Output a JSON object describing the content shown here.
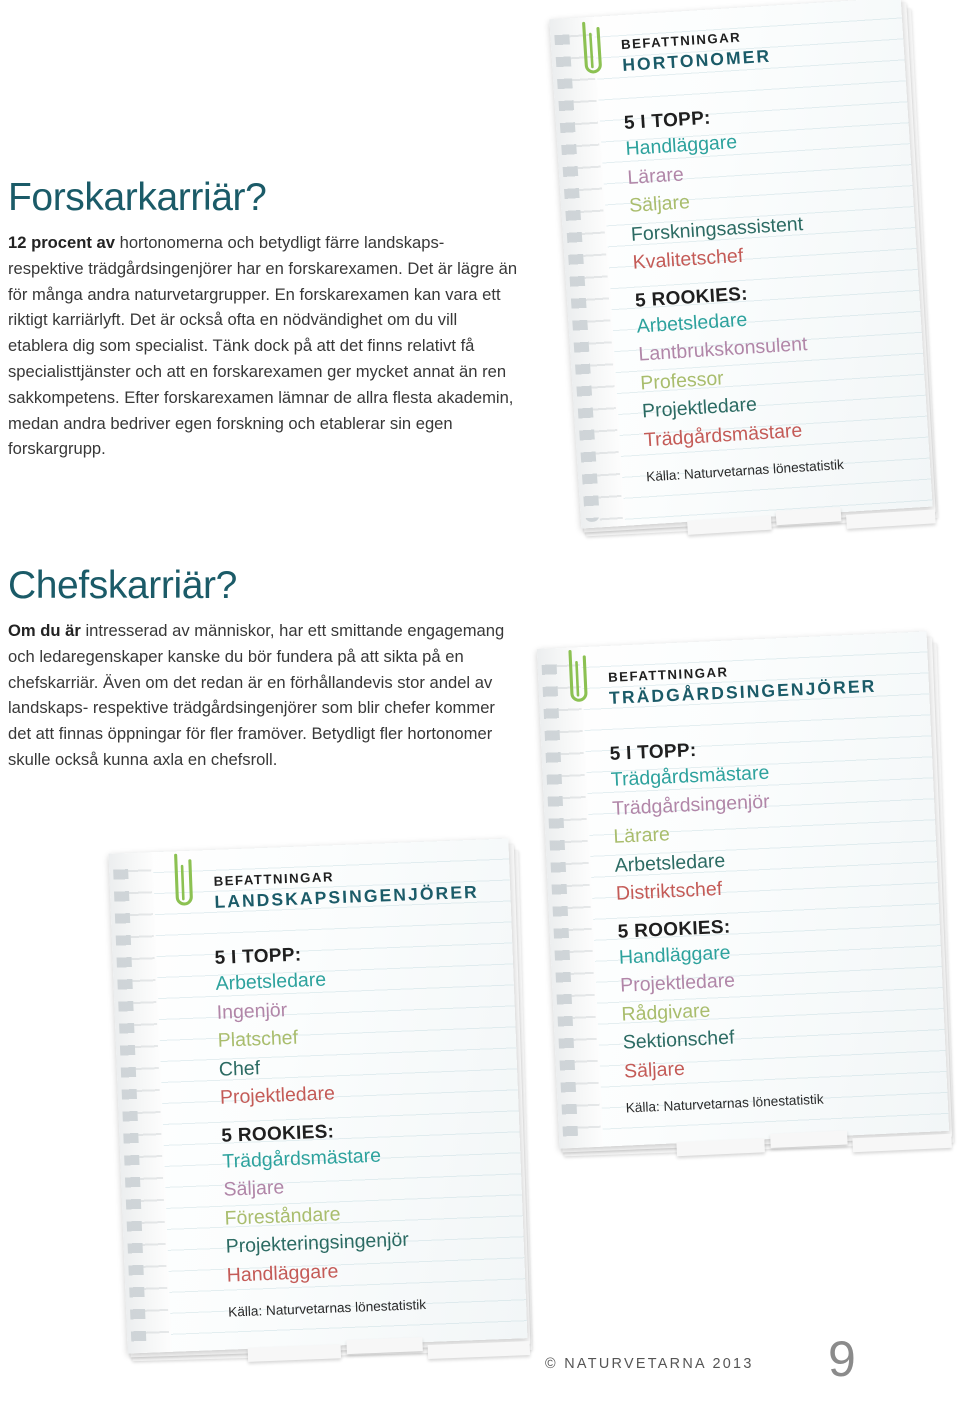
{
  "page": {
    "number": "9",
    "copyright": "© NATURVETARNA 2013"
  },
  "sections": [
    {
      "id": "forskarkarriar",
      "headline": "Forskarkarriär?",
      "lead": "12 procent av",
      "body": " hortonomerna och betydligt färre landskaps- respektive trädgårdsingenjörer har en forskarexamen. Det är lägre än för många andra naturvetargrupper. En forskarexamen kan vara ett riktigt karriärlyft. Det är också ofta en nödvändighet om du vill etablera dig som specialist. Tänk dock på att det finns relativt få specialisttjänster och att en forskarexamen ger mycket annat än ren sakkompetens. Efter forskarexamen lämnar de allra flesta akademin, medan andra bedriver egen forskning och etablerar sin egen forskargrupp."
    },
    {
      "id": "chefskarriar",
      "headline": "Chefskarriär?",
      "lead": "Om du är",
      "body": " intresserad av människor, har ett smittande engagemang och ledaregenskaper kanske du bör fundera på att sikta på en chefskarriär. Även om det redan är en förhållandevis stor andel av landskaps- respektive trädgårdsingenjörer som blir chefer kommer det att finnas öppningar för fler framöver. Betydligt fler hortonomer skulle också kunna axla en chefsroll."
    }
  ],
  "notepads": [
    {
      "id": "hortonomer",
      "kicker": "BEFATTNINGAR",
      "category": "HORTONOMER",
      "top_label": "5 I TOPP:",
      "top_list": [
        "Handläggare",
        "Lärare",
        "Säljare",
        "Forskningsassistent",
        "Kvalitetschef"
      ],
      "rookies_label": "5 ROOKIES:",
      "rookies_list": [
        "Arbetsledare",
        "Lantbrukskonsulent",
        "Professor",
        "Projektledare",
        "Trädgårdsmästare"
      ],
      "source": "Källa: Naturvetarnas lönestatistik",
      "clip": "paperclip-icon"
    },
    {
      "id": "tradgardsingenjorer",
      "kicker": "BEFATTNINGAR",
      "category": "TRÄDGÅRDSINGENJÖRER",
      "top_label": "5 I TOPP:",
      "top_list": [
        "Trädgårdsmästare",
        "Trädgårdsingenjör",
        "Lärare",
        "Arbetsledare",
        "Distriktschef"
      ],
      "rookies_label": "5 ROOKIES:",
      "rookies_list": [
        "Handläggare",
        "Projektledare",
        "Rådgivare",
        "Sektionschef",
        "Säljare"
      ],
      "source": "Källa: Naturvetarnas lönestatistik",
      "clip": "paperclip-icon"
    },
    {
      "id": "landskapsingenjorer",
      "kicker": "BEFATTNINGAR",
      "category": "LANDSKAPSINGENJÖRER",
      "top_label": "5 I TOPP:",
      "top_list": [
        "Arbetsledare",
        "Ingenjör",
        "Platschef",
        "Chef",
        "Projektledare"
      ],
      "rookies_label": "5 ROOKIES:",
      "rookies_list": [
        "Trädgårdsmästare",
        "Säljare",
        "Föreståndare",
        "Projekteringsingenjör",
        "Handläggare"
      ],
      "source": "Källa: Naturvetarnas lönestatistik",
      "clip": "paperclip-icon"
    }
  ],
  "colors": {
    "headline": "#1b5b68",
    "category": "#1b5b68",
    "body": "#383838",
    "list_1": "#2da29d",
    "list_2": "#b186a8",
    "list_3": "#a9bd6d",
    "list_4": "#2c6b63",
    "list_5": "#c45b57",
    "paperclip": "#8cc152"
  }
}
